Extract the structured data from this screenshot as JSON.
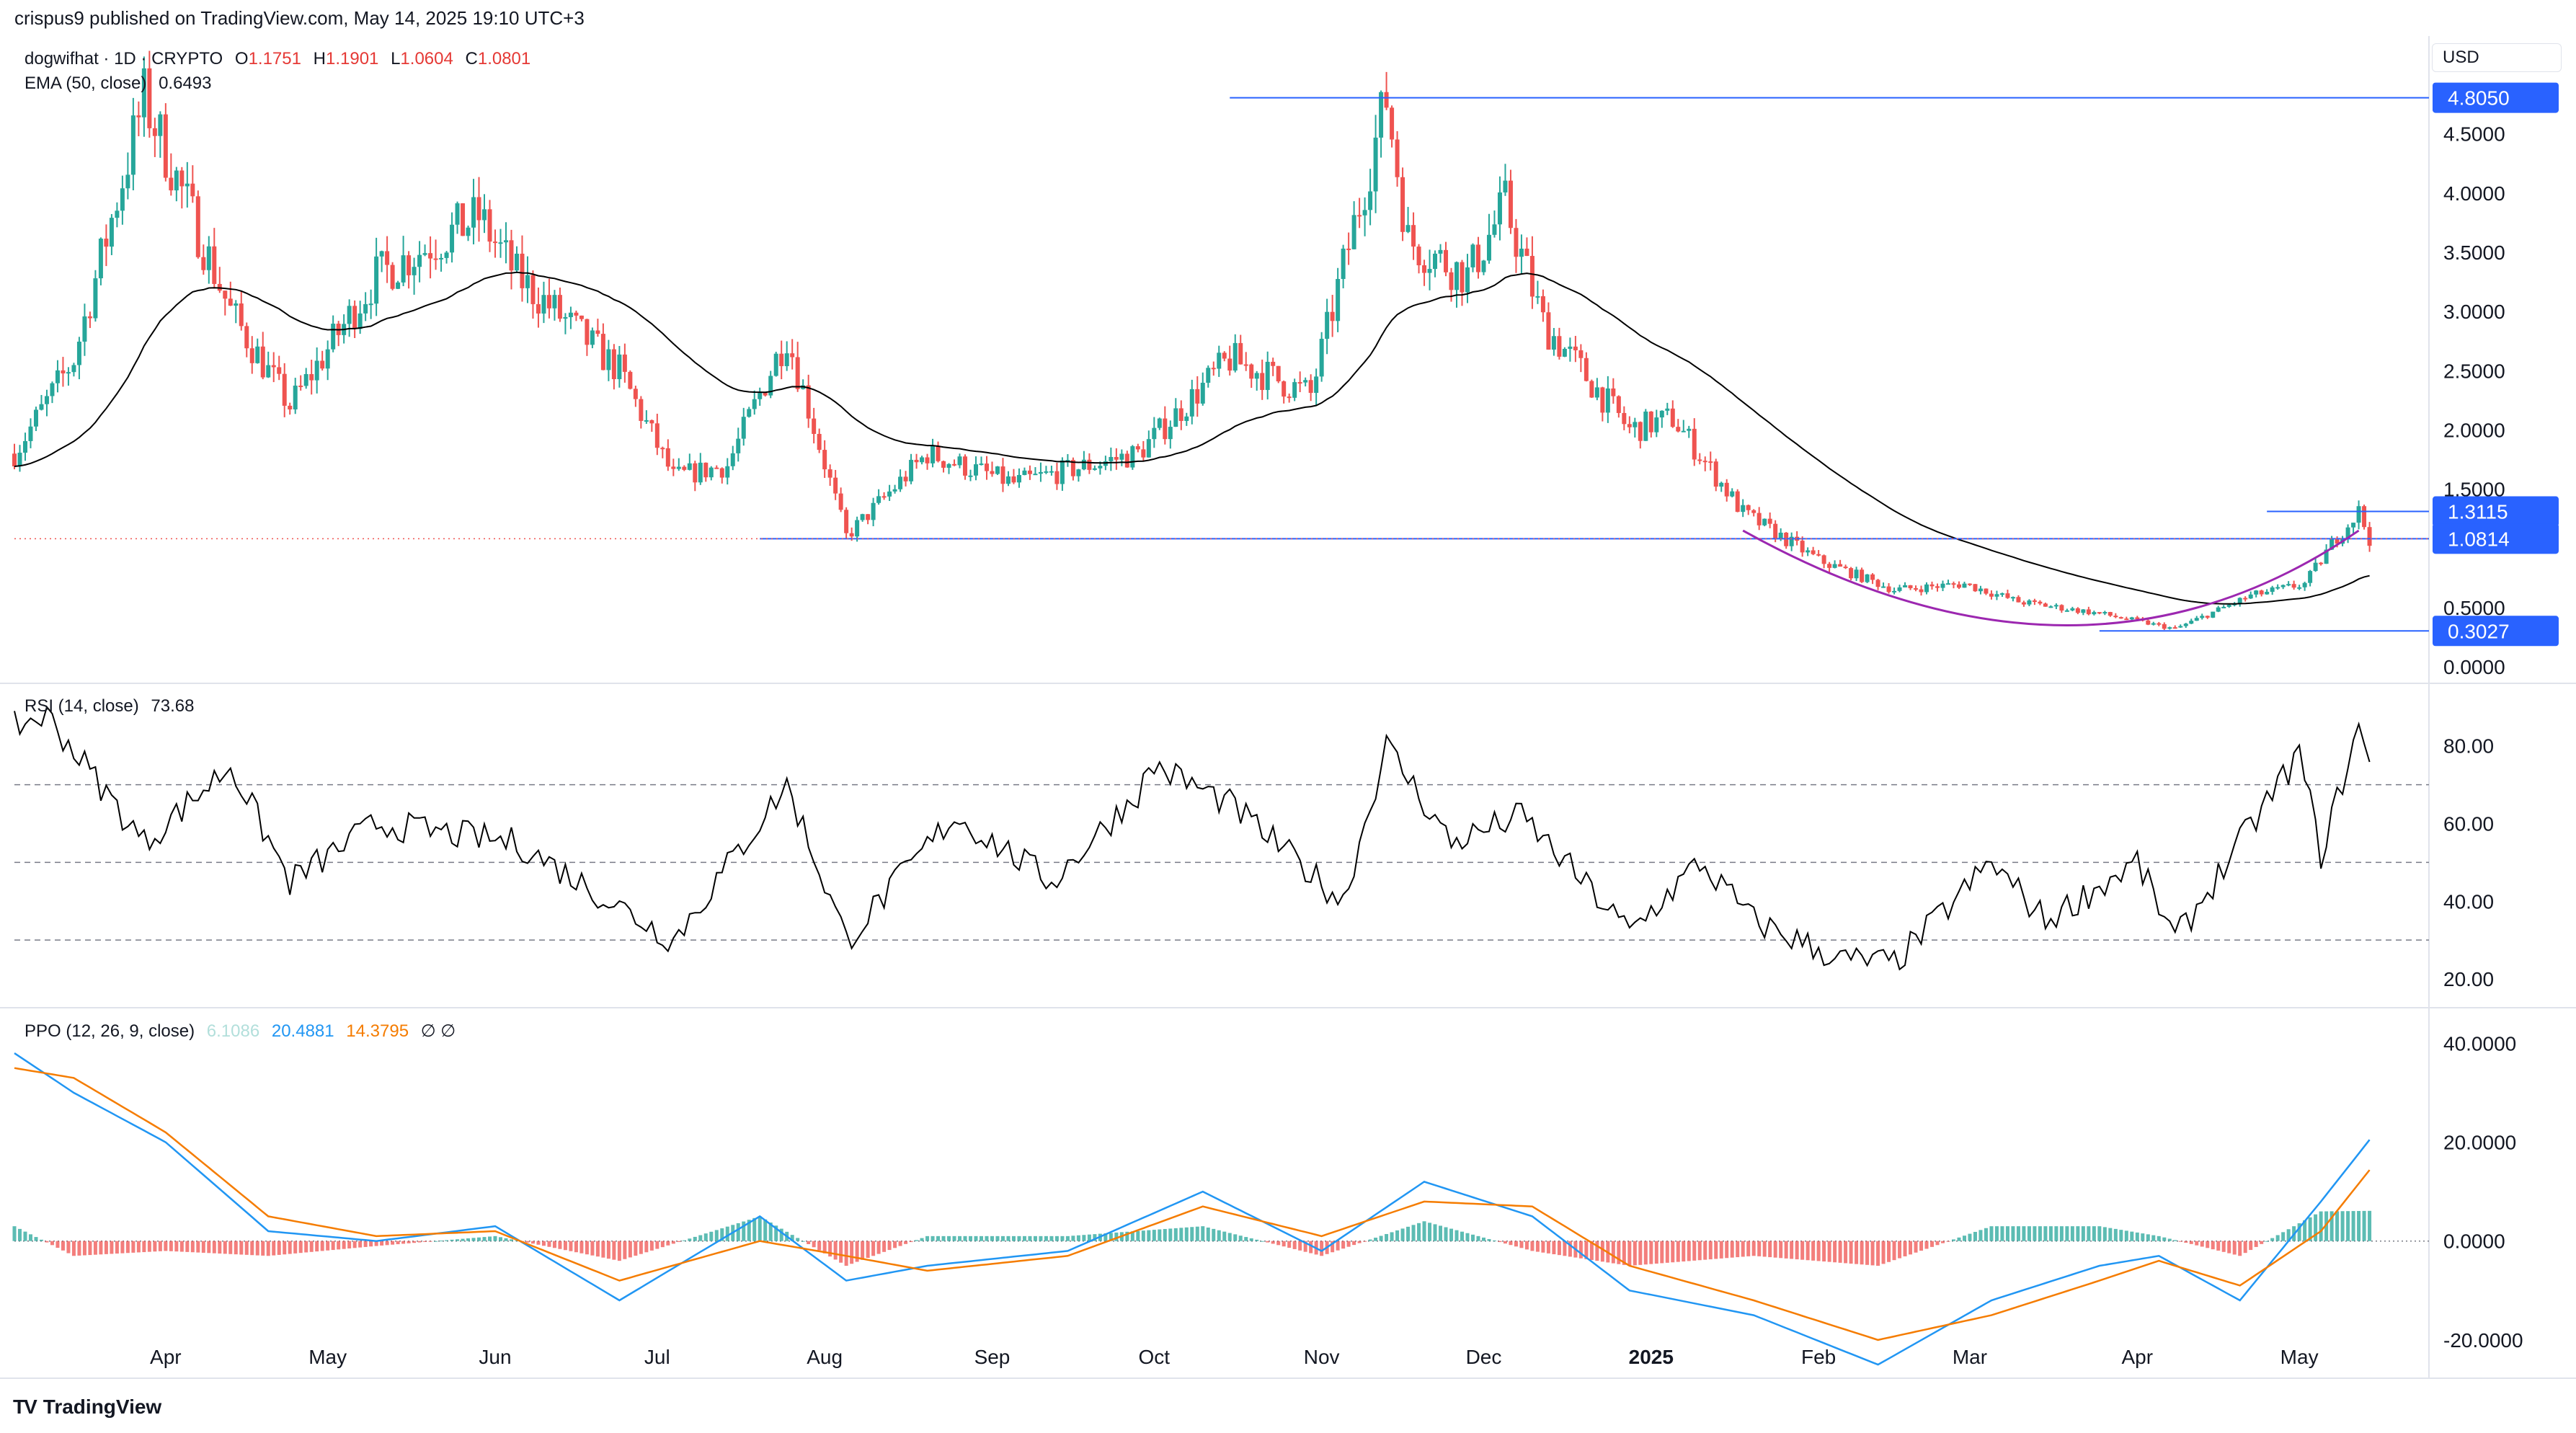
{
  "header": {
    "published": "crispus9 published on TradingView.com, May 14, 2025 19:10 UTC+3"
  },
  "legend": {
    "symbol": "dogwifhat · 1D · CRYPTO",
    "open_label": "O",
    "open": "1.1751",
    "high_label": "H",
    "high": "1.1901",
    "low_label": "L",
    "low": "1.0604",
    "close_label": "C",
    "close": "1.0801",
    "ema_label": "EMA (50, close)",
    "ema_value": "0.6493",
    "rsi_label": "RSI (14, close)",
    "rsi_value": "73.68",
    "ppo_label": "PPO (12, 26, 9, close)",
    "ppo_hist": "6.1086",
    "ppo_line": "20.4881",
    "ppo_signal": "14.3795",
    "ppo_extra": "∅ ∅"
  },
  "currency": "USD",
  "footer": {
    "brand": "TradingView",
    "logo": "TV"
  },
  "colors": {
    "up": "#26a69a",
    "down": "#ef5350",
    "ema": "#000000",
    "hline": "#2962ff",
    "cup": "#9c27b0",
    "rsi": "#000000",
    "ppo_line": "#2196f3",
    "ppo_signal": "#f57c00",
    "axis_label_bg": "#2962ff"
  },
  "chart_data": [
    {
      "type": "candlestick",
      "title": "dogwifhat · 1D · CRYPTO",
      "ylim": [
        0,
        4.9
      ],
      "y_ticks": [
        "0.0000",
        "0.5000",
        "1.5000",
        "2.0000",
        "2.5000",
        "3.0000",
        "3.5000",
        "4.0000",
        "4.5000"
      ],
      "x_ticks": [
        "Apr",
        "May",
        "Jun",
        "Jul",
        "Aug",
        "Sep",
        "Oct",
        "Nov",
        "Dec",
        "2025",
        "Feb",
        "Mar",
        "Apr",
        "May"
      ],
      "price_anchors": {
        "x": [
          "2024-03-04",
          "2024-03-15",
          "2024-03-28",
          "2024-04-13",
          "2024-04-24",
          "2024-05-10",
          "2024-05-29",
          "2024-06-05",
          "2024-06-24",
          "2024-07-04",
          "2024-07-14",
          "2024-07-25",
          "2024-08-05",
          "2024-08-20",
          "2024-09-05",
          "2024-09-28",
          "2024-10-15",
          "2024-10-30",
          "2024-11-13",
          "2024-11-17",
          "2024-11-28",
          "2024-12-05",
          "2024-12-12",
          "2024-12-28",
          "2025-01-05",
          "2025-01-18",
          "2025-02-01",
          "2025-02-15",
          "2025-02-28",
          "2025-03-10",
          "2025-03-25",
          "2025-04-08",
          "2025-04-22",
          "2025-05-02",
          "2025-05-08",
          "2025-05-12",
          "2025-05-14"
        ],
        "values": [
          1.8,
          2.6,
          4.8,
          3.0,
          2.2,
          3.3,
          3.8,
          3.3,
          2.5,
          1.6,
          1.7,
          2.8,
          1.1,
          1.8,
          1.55,
          1.8,
          2.6,
          2.3,
          4.8,
          3.6,
          3.3,
          3.9,
          2.9,
          2.0,
          2.1,
          1.3,
          0.9,
          0.65,
          0.7,
          0.55,
          0.45,
          0.32,
          0.6,
          0.7,
          1.1,
          1.31,
          1.08
        ]
      },
      "ema_label": "EMA (50, close)",
      "ema_last": 0.6493,
      "horizontal_levels": [
        4.805,
        1.3115,
        1.0814,
        0.3027
      ],
      "level_labels": [
        "4.8050",
        "1.3115",
        "1.0814",
        "0.3027"
      ],
      "annotations": [
        "rounded bottom arc Feb–May 2025"
      ]
    },
    {
      "type": "line",
      "title": "RSI (14, close)",
      "ylim": [
        15,
        92
      ],
      "y_ticks": [
        "20.00",
        "40.00",
        "60.00",
        "80.00"
      ],
      "levels": [
        70,
        50,
        30
      ],
      "last": 73.68,
      "x": [
        "2024-03-04",
        "2024-03-10",
        "2024-03-28",
        "2024-04-13",
        "2024-04-24",
        "2024-05-10",
        "2024-06-05",
        "2024-07-04",
        "2024-07-25",
        "2024-08-05",
        "2024-08-25",
        "2024-09-12",
        "2024-09-28",
        "2024-10-01",
        "2024-10-15",
        "2024-11-05",
        "2024-11-13",
        "2024-11-25",
        "2024-12-08",
        "2024-12-28",
        "2025-01-10",
        "2025-01-20",
        "2025-02-05",
        "2025-02-15",
        "2025-03-05",
        "2025-03-15",
        "2025-04-01",
        "2025-04-08",
        "2025-04-20",
        "2025-05-01",
        "2025-05-05",
        "2025-05-12",
        "2025-05-14"
      ],
      "values": [
        85,
        88,
        55,
        75,
        45,
        60,
        55,
        30,
        70,
        30,
        62,
        45,
        68,
        75,
        65,
        40,
        80,
        55,
        62,
        32,
        50,
        35,
        25,
        24,
        50,
        35,
        50,
        30,
        55,
        78,
        52,
        85,
        73.68
      ]
    },
    {
      "type": "line",
      "title": "PPO (12, 26, 9, close)",
      "ylim": [
        -26,
        44
      ],
      "y_ticks": [
        "40.0000",
        "20.0000",
        "0.0000",
        "-20.0000"
      ],
      "series": [
        {
          "name": "PPO",
          "last": 20.4881,
          "x": [
            "2024-03-04",
            "2024-03-15",
            "2024-04-01",
            "2024-04-20",
            "2024-05-10",
            "2024-06-01",
            "2024-06-24",
            "2024-07-20",
            "2024-08-05",
            "2024-08-20",
            "2024-09-15",
            "2024-10-10",
            "2024-11-01",
            "2024-11-20",
            "2024-12-10",
            "2024-12-28",
            "2025-01-20",
            "2025-02-12",
            "2025-03-05",
            "2025-03-25",
            "2025-04-05",
            "2025-04-20",
            "2025-05-05",
            "2025-05-14"
          ],
          "values": [
            38,
            30,
            20,
            2,
            0,
            3,
            -12,
            5,
            -8,
            -5,
            -2,
            10,
            -2,
            12,
            5,
            -10,
            -15,
            -25,
            -12,
            -5,
            -3,
            -12,
            8,
            20.4881
          ]
        },
        {
          "name": "Signal",
          "last": 14.3795,
          "x": [
            "2024-03-04",
            "2024-03-15",
            "2024-04-01",
            "2024-04-20",
            "2024-05-10",
            "2024-06-01",
            "2024-06-24",
            "2024-07-20",
            "2024-08-05",
            "2024-08-20",
            "2024-09-15",
            "2024-10-10",
            "2024-11-01",
            "2024-11-20",
            "2024-12-10",
            "2024-12-28",
            "2025-01-20",
            "2025-02-12",
            "2025-03-05",
            "2025-03-25",
            "2025-04-05",
            "2025-04-20",
            "2025-05-05",
            "2025-05-14"
          ],
          "values": [
            35,
            33,
            22,
            5,
            1,
            2,
            -8,
            0,
            -3,
            -6,
            -3,
            7,
            1,
            8,
            7,
            -5,
            -12,
            -20,
            -15,
            -8,
            -4,
            -9,
            2,
            14.3795
          ]
        },
        {
          "name": "Histogram",
          "last": 6.1086
        }
      ]
    }
  ]
}
